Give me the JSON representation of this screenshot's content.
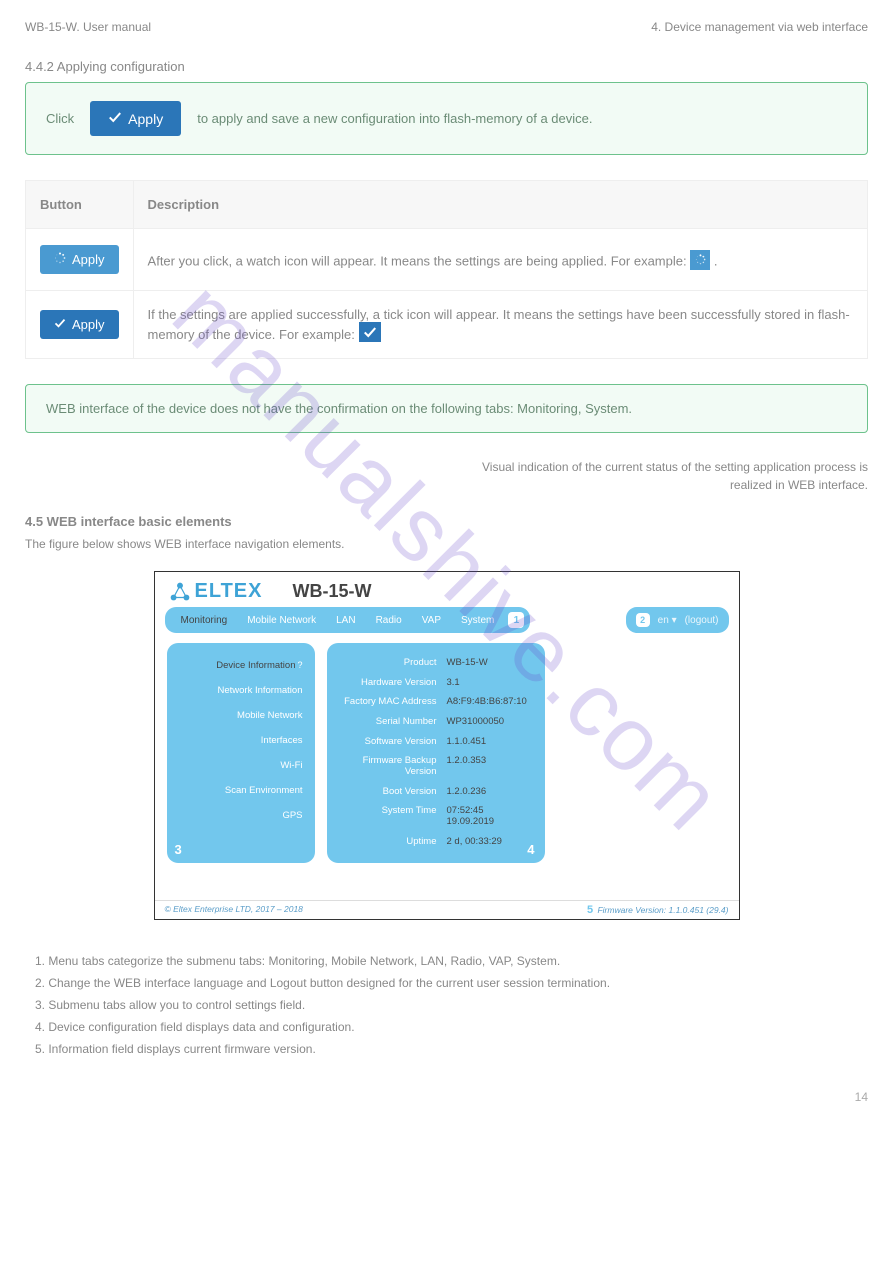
{
  "header": {
    "left": "WB-15-W. User manual",
    "right_heading": "4. Device management via web interface",
    "section_label": "4.4.2 Applying configuration"
  },
  "callout1": {
    "pre_text": "Click ",
    "btn_label": "Apply",
    "post_text": " to apply and save a new configuration into flash-memory of a device."
  },
  "legend": {
    "col1": "Button",
    "col2": "Description",
    "rows": [
      {
        "btn_label": "Apply",
        "desc_p1": "After you click, a watch icon  will appear. It means the settings are being applied. For example: ",
        "spinner_alt": "."
      },
      {
        "btn_label": "Apply",
        "desc_p1": "If the settings are applied successfully, a tick icon will appear. It means the settings have been successfully stored in flash-memory of the device. For example: "
      }
    ]
  },
  "callout2": "WEB interface of the device does not have the confirmation on the following tabs: Monitoring, System.",
  "note": {
    "line1": "Visual indication of the current status of the setting application process is",
    "line2": "realized in WEB interface.",
    "heading": "4.5 WEB interface basic elements",
    "subheading": "The figure below shows WEB interface navigation elements."
  },
  "ui": {
    "logo_text": "ELTEX",
    "product": "WB-15-W",
    "menu": [
      "Monitoring",
      "Mobile Network",
      "LAN",
      "Radio",
      "VAP",
      "System"
    ],
    "menu_badge_1": "1",
    "right_badge_2": "2",
    "lang": "en",
    "logout": "(logout)",
    "sidebar": [
      "Device Information",
      "Network Information",
      "Mobile Network",
      "Interfaces",
      "Wi-Fi",
      "Scan Environment",
      "GPS"
    ],
    "badge_3": "3",
    "info": [
      {
        "label": "Product",
        "value": "WB-15-W"
      },
      {
        "label": "Hardware Version",
        "value": "3.1"
      },
      {
        "label": "Factory MAC Address",
        "value": "A8:F9:4B:B6:87:10"
      },
      {
        "label": "Serial Number",
        "value": "WP31000050"
      },
      {
        "label": "Software Version",
        "value": "1.1.0.451"
      },
      {
        "label": "Firmware Backup Version",
        "value": "1.2.0.353"
      },
      {
        "label": "Boot Version",
        "value": "1.2.0.236"
      },
      {
        "label": "System Time",
        "value": "07:52:45 19.09.2019"
      },
      {
        "label": "Uptime",
        "value": "2 d, 00:33:29"
      }
    ],
    "badge_4": "4",
    "footer_left": "© Eltex Enterprise LTD, 2017 – 2018",
    "footer_badge_5": "5",
    "footer_right": "Firmware Version: 1.1.0.451 (29.4)"
  },
  "list": [
    "1. Menu tabs categorize the submenu tabs: Monitoring, Mobile Network, LAN, Radio, VAP, System.",
    "2. Change the WEB interface language and Logout button designed for the current user session termination.",
    "3. Submenu tabs allow you to control settings field.",
    "4. Device configuration field displays data and configuration.",
    "5. Information field displays current firmware version."
  ],
  "page_num": "14",
  "watermark": "manualshive.com"
}
